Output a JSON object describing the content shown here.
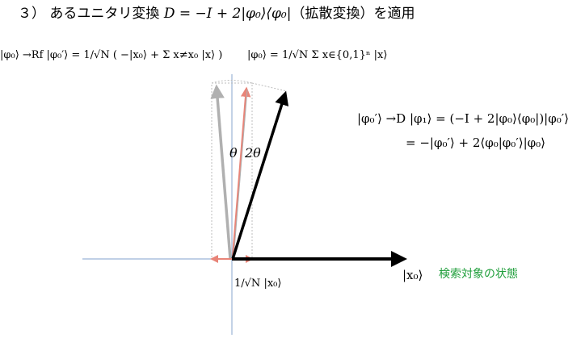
{
  "title": {
    "prefix": "３） あるユニタリ変換 ",
    "formula": "D = −I + 2|φ₀⟩⟨φ₀|",
    "suffix": "（拡散変換）を適用"
  },
  "equations": {
    "reflection_lhs": "|φ₀⟩ →Rf |φ₀′⟩ =",
    "reflection_rhs": "1/√N ( −|x₀⟩ + Σ x≠x₀ |x⟩ )",
    "phi0_def_lhs": "|φ₀⟩ =",
    "phi0_def_rhs": "1/√N Σ x∈{0,1}ⁿ |x⟩",
    "diffusion_line1": "|φ₀′⟩ →D |φ₁⟩ = (−I + 2|φ₀⟩⟨φ₀|)|φ₀′⟩",
    "diffusion_line2": "= −|φ₀′⟩ + 2⟨φ₀|φ₀′⟩|φ₀⟩",
    "x0_component": "1/√N |x₀⟩"
  },
  "labels": {
    "theta": "θ",
    "two_theta": "2θ",
    "x0": "|x₀⟩",
    "target_state": "検索対象の状態"
  },
  "colors": {
    "axis": "#9bb4d6",
    "red_arrow": "#e88478",
    "gray_arrow": "#b0b0b0",
    "black_arrow": "#000000",
    "green_text": "#1e9e3a",
    "dotted": "#bdbdbd"
  }
}
